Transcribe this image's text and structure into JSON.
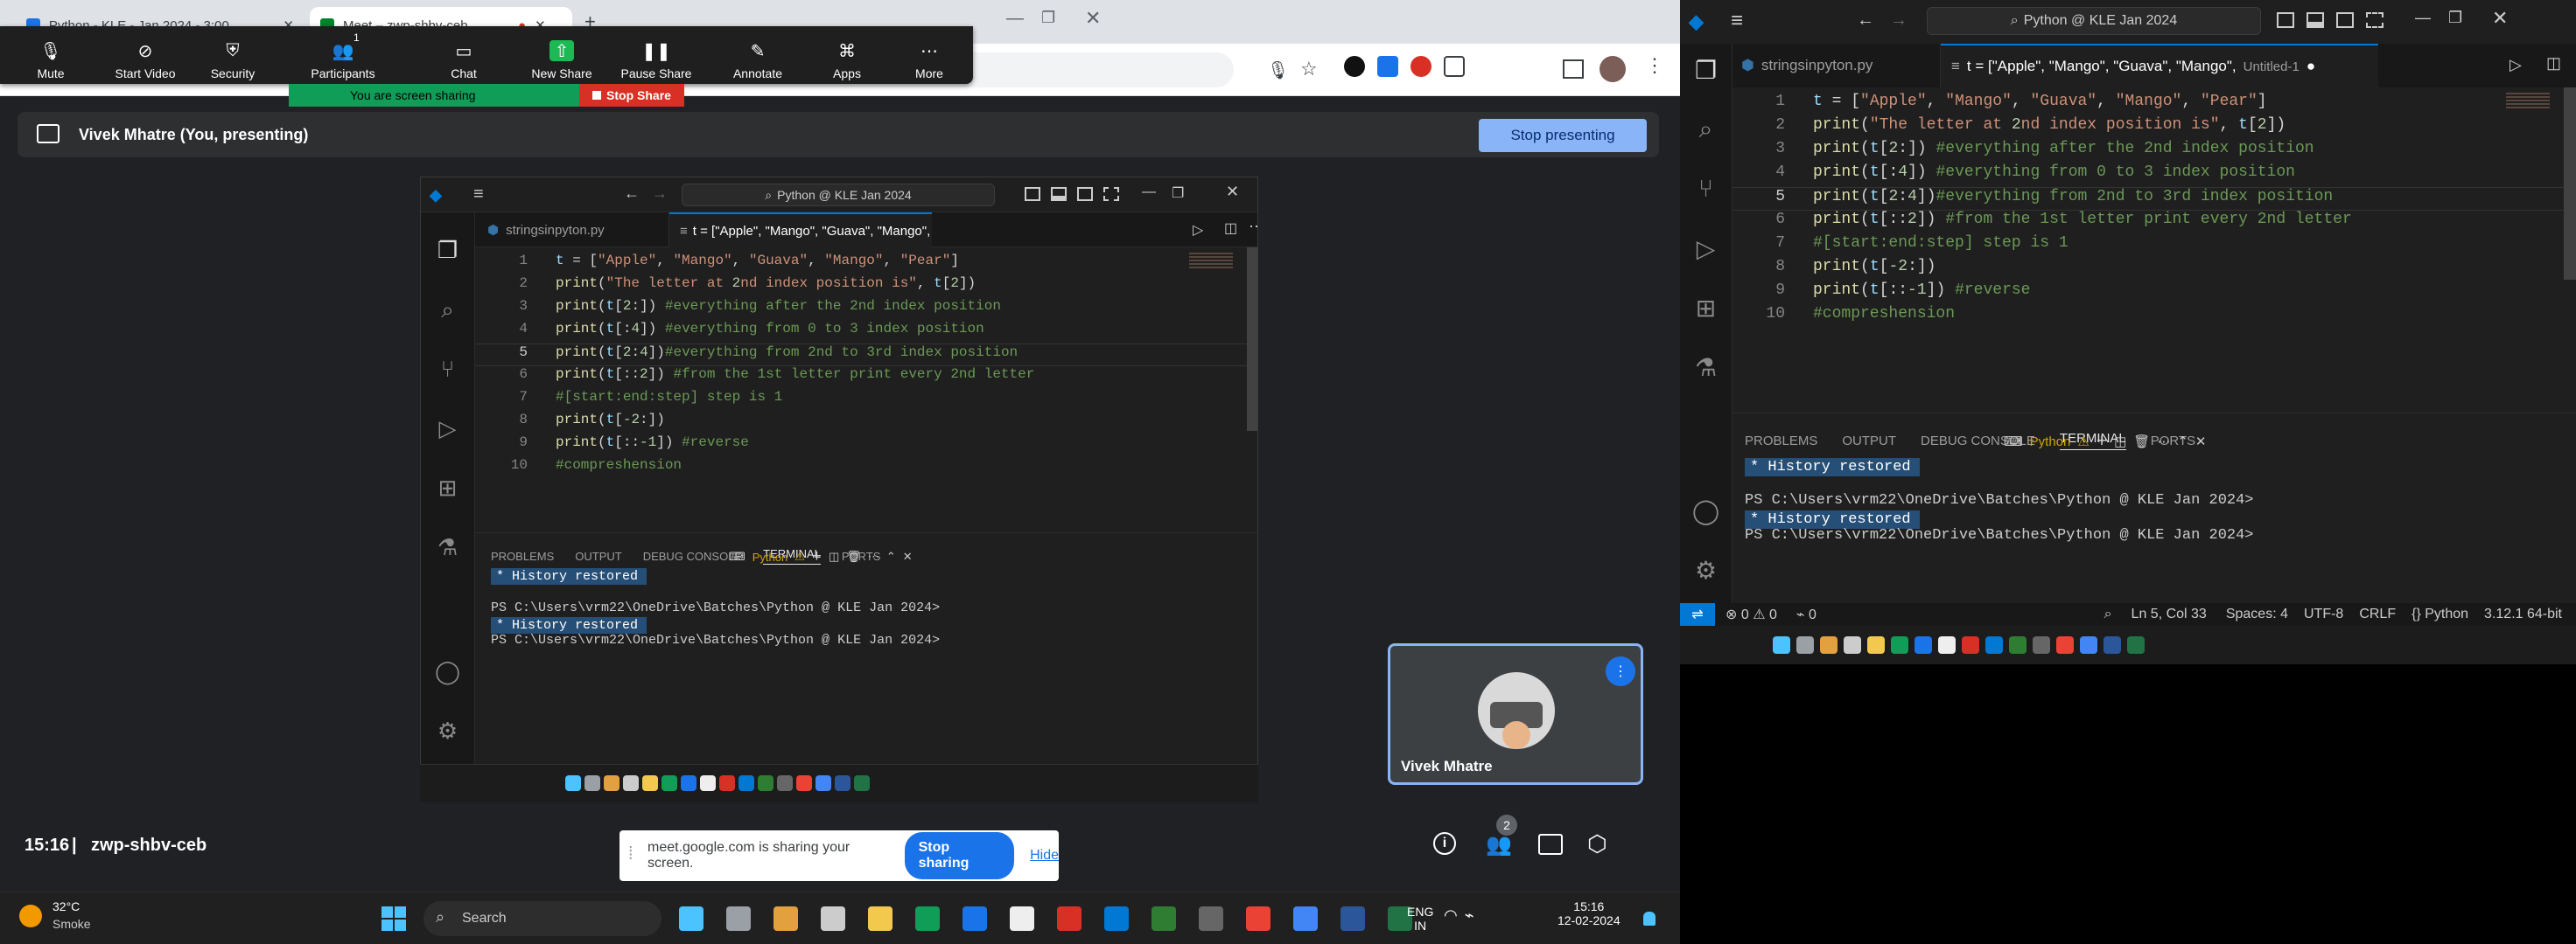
{
  "chrome": {
    "tabs": [
      {
        "label": "Python - KLE - Jan 2024 - 3:00"
      },
      {
        "label": "Meet – zwp-shbv-ceb"
      }
    ]
  },
  "zoom": {
    "buttons": [
      {
        "label": "Mute",
        "icon": "mic-icon"
      },
      {
        "label": "Start Video",
        "icon": "video-off-icon"
      },
      {
        "label": "Security",
        "icon": "shield-icon"
      },
      {
        "label": "Participants",
        "icon": "people-icon",
        "count": "1"
      },
      {
        "label": "Chat",
        "icon": "chat-icon"
      },
      {
        "label": "New Share",
        "icon": "share-icon"
      },
      {
        "label": "Pause Share",
        "icon": "pause-icon"
      },
      {
        "label": "Annotate",
        "icon": "pen-icon"
      },
      {
        "label": "Apps",
        "icon": "apps-icon"
      },
      {
        "label": "More",
        "icon": "more-icon"
      }
    ],
    "sharing_text": "You are screen sharing",
    "stop_share": "Stop Share"
  },
  "meet": {
    "presenting_label": "Vivek Mhatre (You, presenting)",
    "stop_presenting": "Stop presenting",
    "time": "15:16",
    "meeting_code": "zwp-shbv-ceb",
    "tile_name": "Vivek Mhatre",
    "people_count": "2",
    "notice_text": "meet.google.com is sharing your screen.",
    "notice_stop": "Stop sharing",
    "notice_hide": "Hide"
  },
  "vscode": {
    "search": "Python @ KLE Jan 2024",
    "tab1": "stringsinpyton.py",
    "tab2": "t = [\"Apple\", \"Mango\", \"Guava\", \"Mango\",",
    "tab2_suffix": "Untitled-1",
    "lines": [
      "t = [\"Apple\", \"Mango\", \"Guava\", \"Mango\", \"Pear\"]",
      "print(\"The letter at 2nd index position is\", t[2])",
      "print(t[2:]) #everything after the 2nd index position",
      "print(t[:4]) #everything from 0 to 3 index position",
      "print(t[2:4])#everything from 2nd to 3rd index position",
      "print(t[::2]) #from the 1st letter print every 2nd letter",
      "#[start:end:step] step is 1",
      "print(t[-2:])",
      "print(t[::-1]) #reverse",
      "#compreshension"
    ],
    "line_numbers": [
      "1",
      "2",
      "3",
      "4",
      "5",
      "6",
      "7",
      "8",
      "9",
      "10"
    ],
    "panel_tabs": [
      "PROBLEMS",
      "OUTPUT",
      "DEBUG CONSOLE",
      "TERMINAL",
      "PORTS"
    ],
    "terminal_label": "Python",
    "terminal": {
      "history": "* History restored",
      "prompt": "PS C:\\Users\\vrm22\\OneDrive\\Batches\\Python @ KLE Jan 2024>"
    },
    "status": {
      "errors": "0",
      "warnings": "0",
      "ports": "0",
      "position": "Ln 5, Col 33",
      "spaces": "Spaces: 4",
      "encoding": "UTF-8",
      "eol": "CRLF",
      "language": "Python",
      "version": "3.12.1 64-bit"
    }
  },
  "windows": {
    "weather_temp": "32°C",
    "weather_desc": "Smoke",
    "search": "Search",
    "lang1": "ENG",
    "lang2": "IN",
    "time": "15:16",
    "date": "12-02-2024"
  },
  "colors": {
    "accent": "#8ab4f8",
    "vscode_blue": "#0078d4",
    "share_green": "#0f9d58",
    "stop_red": "#d93025"
  }
}
